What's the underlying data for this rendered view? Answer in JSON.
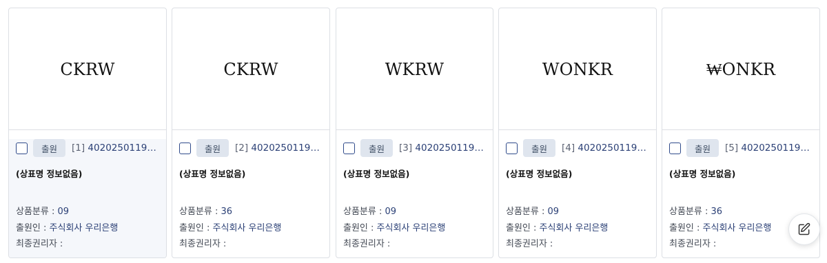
{
  "cards": [
    {
      "mark": "CKRW",
      "status": "출원",
      "index": "[1]",
      "app_number": "4020250119…",
      "title": "(상표명 정보없음)",
      "class_label": "상품분류 : ",
      "class_value": "09",
      "applicant_label": "출원인 : ",
      "applicant_value": "주식회사 우리은행",
      "final_right_label": "최종권리자 : ",
      "final_right_value": ""
    },
    {
      "mark": "CKRW",
      "status": "출원",
      "index": "[2]",
      "app_number": "4020250119…",
      "title": "(상표명 정보없음)",
      "class_label": "상품분류 : ",
      "class_value": "36",
      "applicant_label": "출원인 : ",
      "applicant_value": "주식회사 우리은행",
      "final_right_label": "최종권리자 : ",
      "final_right_value": ""
    },
    {
      "mark": "WKRW",
      "status": "출원",
      "index": "[3]",
      "app_number": "4020250119…",
      "title": "(상표명 정보없음)",
      "class_label": "상품분류 : ",
      "class_value": "09",
      "applicant_label": "출원인 : ",
      "applicant_value": "주식회사 우리은행",
      "final_right_label": "최종권리자 : ",
      "final_right_value": ""
    },
    {
      "mark": "WONKR",
      "status": "출원",
      "index": "[4]",
      "app_number": "4020250119…",
      "title": "(상표명 정보없음)",
      "class_label": "상품분류 : ",
      "class_value": "09",
      "applicant_label": "출원인 : ",
      "applicant_value": "주식회사 우리은행",
      "final_right_label": "최종권리자 : ",
      "final_right_value": ""
    },
    {
      "mark": "₩ONKR",
      "status": "출원",
      "index": "[5]",
      "app_number": "4020250119…",
      "title": "(상표명 정보없음)",
      "class_label": "상품분류 : ",
      "class_value": "36",
      "applicant_label": "출원인 : ",
      "applicant_value": "주식회사 우리은행",
      "final_right_label": "최종권리자 : ",
      "final_right_value": ""
    }
  ],
  "fab": {
    "icon": "edit-icon"
  },
  "colors": {
    "accent": "#2a3f75",
    "badge_bg": "#dfe5ee",
    "border": "#dcdfe4"
  }
}
